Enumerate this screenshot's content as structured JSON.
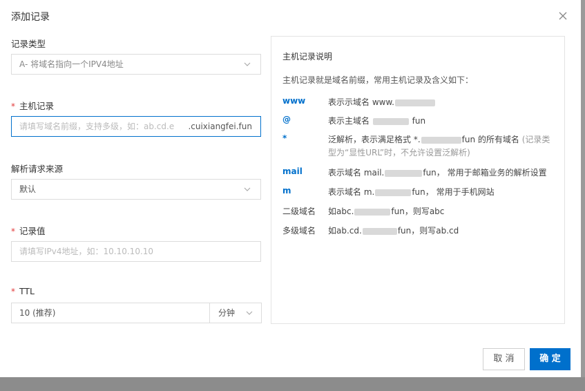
{
  "dialog": {
    "title": "添加记录",
    "close_icon": "close-icon"
  },
  "form": {
    "record_type": {
      "label": "记录类型",
      "value": "A- 将域名指向一个IPV4地址"
    },
    "host": {
      "label": "主机记录",
      "placeholder": "请填写域名前缀，支持多级，如：ab.cd.e",
      "suffix": ".cuixiangfei.fun"
    },
    "source": {
      "label": "解析请求来源",
      "value": "默认"
    },
    "record_value": {
      "label": "记录值",
      "placeholder": "请填写IPv4地址，如：10.10.10.10"
    },
    "ttl": {
      "label": "TTL",
      "value": "10 (推荐)",
      "unit": "分钟"
    },
    "required_mark": "*"
  },
  "help": {
    "title": "主机记录说明",
    "intro": "主机记录就是域名前缀，常用主机记录及含义如下：",
    "rows": [
      {
        "key": "www",
        "pre": "表示示域名 www.",
        "post": ""
      },
      {
        "key": "@",
        "pre": "表示主域名",
        "post": "fun"
      },
      {
        "key": "*",
        "pre": "泛解析，表示满足格式 *.",
        "post": "fun 的所有域名",
        "note": "(记录类型为“显性URL”时，不允许设置泛解析)"
      },
      {
        "key": "mail",
        "pre": "表示域名 mail.",
        "post": "fun， 常用于邮箱业务的解析设置"
      },
      {
        "key": "m",
        "pre": "表示域名 m.",
        "post": "fun， 常用于手机网站"
      },
      {
        "key": "二级域名",
        "pre": "如abc.",
        "post": "fun，则写abc"
      },
      {
        "key": "多级域名",
        "pre": "如ab.cd.",
        "post": "fun，则写ab.cd"
      }
    ]
  },
  "footer": {
    "cancel_label": "取 消",
    "ok_label": "确 定"
  },
  "colors": {
    "accent": "#0070cc",
    "required": "#e23a3a",
    "border": "#dcdcdc"
  }
}
